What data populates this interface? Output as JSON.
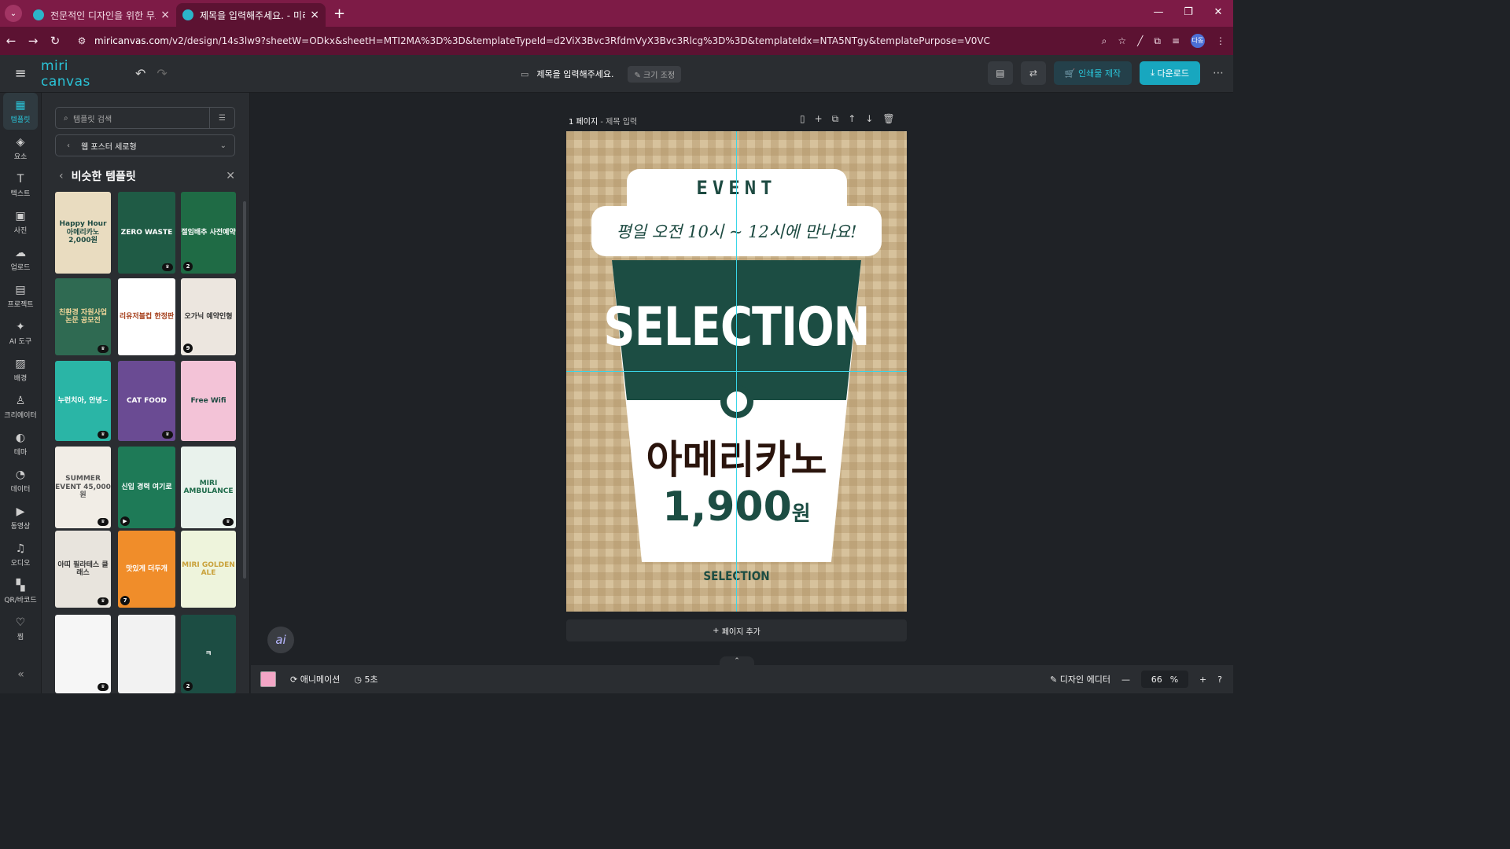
{
  "browser": {
    "tabs": [
      {
        "title": "전문적인 디자인을 위한 무료 /",
        "active": false
      },
      {
        "title": "제목을 입력해주세요. - 미리캔",
        "active": true
      }
    ],
    "url_host": "miricanvas.com",
    "url_path": "/v2/design/14s3lw9?sheetW=ODkx&sheetH=MTI2MA%3D%3D&templateTypeId=d2ViX3Bvc3RfdmVyX3Bvc3Rlcg%3D%3D&templateIdx=NTA5NTgy&templatePurpose=V0VC",
    "profile": "다동"
  },
  "header": {
    "logo": "miri canvas",
    "doc_title": "제목을 입력해주세요.",
    "resize_label": "크기 조정",
    "print_label": "인쇄물 제작",
    "download_label": "다운로드"
  },
  "rail": [
    {
      "label": "템플릿",
      "icon": "▦",
      "active": true
    },
    {
      "label": "요소",
      "icon": "◈"
    },
    {
      "label": "텍스트",
      "icon": "T"
    },
    {
      "label": "사진",
      "icon": "▣"
    },
    {
      "label": "업로드",
      "icon": "☁"
    },
    {
      "label": "프로젝트",
      "icon": "▤"
    },
    {
      "label": "AI 도구",
      "icon": "✦"
    },
    {
      "label": "배경",
      "icon": "▨"
    },
    {
      "label": "크리에이터",
      "icon": "♙"
    },
    {
      "label": "테마",
      "icon": "◐"
    },
    {
      "label": "데이터",
      "icon": "◔"
    },
    {
      "label": "동영상",
      "icon": "▶"
    },
    {
      "label": "오디오",
      "icon": "♫"
    },
    {
      "label": "QR/바코드",
      "icon": "▚"
    },
    {
      "label": "찜",
      "icon": "♡"
    }
  ],
  "panel": {
    "search_placeholder": "템플릿 검색",
    "category": "웹 포스터 세로형",
    "section_title": "비슷한 템플릿",
    "thumbs": [
      {
        "text": "Happy Hour 아메리카노 2,000원",
        "bg": "#e9dcc0",
        "fg": "#1d4a41",
        "badge": ""
      },
      {
        "text": "ZERO WASTE",
        "bg": "#1f5b45",
        "fg": "#ffffff",
        "badge": "crown"
      },
      {
        "text": "절임배추 사전예약",
        "bg": "#1f6b45",
        "fg": "#ffffff",
        "badge": "2"
      },
      {
        "text": "친환경 자원사업 논문 공모전",
        "bg": "#2f6a52",
        "fg": "#f2d79b",
        "badge": "crown"
      },
      {
        "text": "리유저블컵 한정판",
        "bg": "#ffffff",
        "fg": "#a33b16",
        "badge": ""
      },
      {
        "text": "오가닉 예약인형",
        "bg": "#ece6df",
        "fg": "#333333",
        "badge": "9"
      },
      {
        "text": "누런치아, 안녕~",
        "bg": "#2ab5a6",
        "fg": "#ffffff",
        "badge": "crown"
      },
      {
        "text": "CAT FOOD",
        "bg": "#6a4b93",
        "fg": "#ffffff",
        "badge": "crown"
      },
      {
        "text": "Free Wifi",
        "bg": "#f3c3d7",
        "fg": "#1d4a41",
        "badge": ""
      },
      {
        "text": "SUMMER EVENT 45,000원",
        "bg": "#f1ede6",
        "fg": "#555555",
        "badge": "crown"
      },
      {
        "text": "신입 경력 여기로",
        "bg": "#1e7a57",
        "fg": "#ffffff",
        "badge": "play"
      },
      {
        "text": "MIRI AMBULANCE",
        "bg": "#e9f2ec",
        "fg": "#1e6b4a",
        "badge": "crown"
      },
      {
        "text": "아띠 필라테스 클래스",
        "bg": "#e8e4dd",
        "fg": "#333333",
        "badge": "crown"
      },
      {
        "text": "맛있게 더두개",
        "bg": "#f08d2a",
        "fg": "#ffffff",
        "badge": "7"
      },
      {
        "text": "MIRI GOLDEN ALE",
        "bg": "#eef4dc",
        "fg": "#c9a13a",
        "badge": ""
      },
      {
        "text": "",
        "bg": "#f6f6f6",
        "fg": "#333333",
        "badge": "crown"
      },
      {
        "text": "",
        "bg": "#f2f2f2",
        "fg": "#333333",
        "badge": ""
      },
      {
        "text": "ㅋ",
        "bg": "#1c4d43",
        "fg": "#ffffff",
        "badge": "2"
      }
    ]
  },
  "canvas": {
    "page_label": "1 페이지",
    "page_title": "제목 입력",
    "add_page": "페이지 추가"
  },
  "poster": {
    "event": "EVENT",
    "slogan": "평일 오전 10시 ~ 12시에 만나요!",
    "selection": "SELECTION",
    "product": "아메리카노",
    "price": "1,900",
    "currency": "원",
    "footer": "SELECTION"
  },
  "bottom": {
    "animation": "애니메이션",
    "duration": "5초",
    "design_editor": "디자인 에디터",
    "zoom": "66",
    "zoom_unit": "%"
  }
}
